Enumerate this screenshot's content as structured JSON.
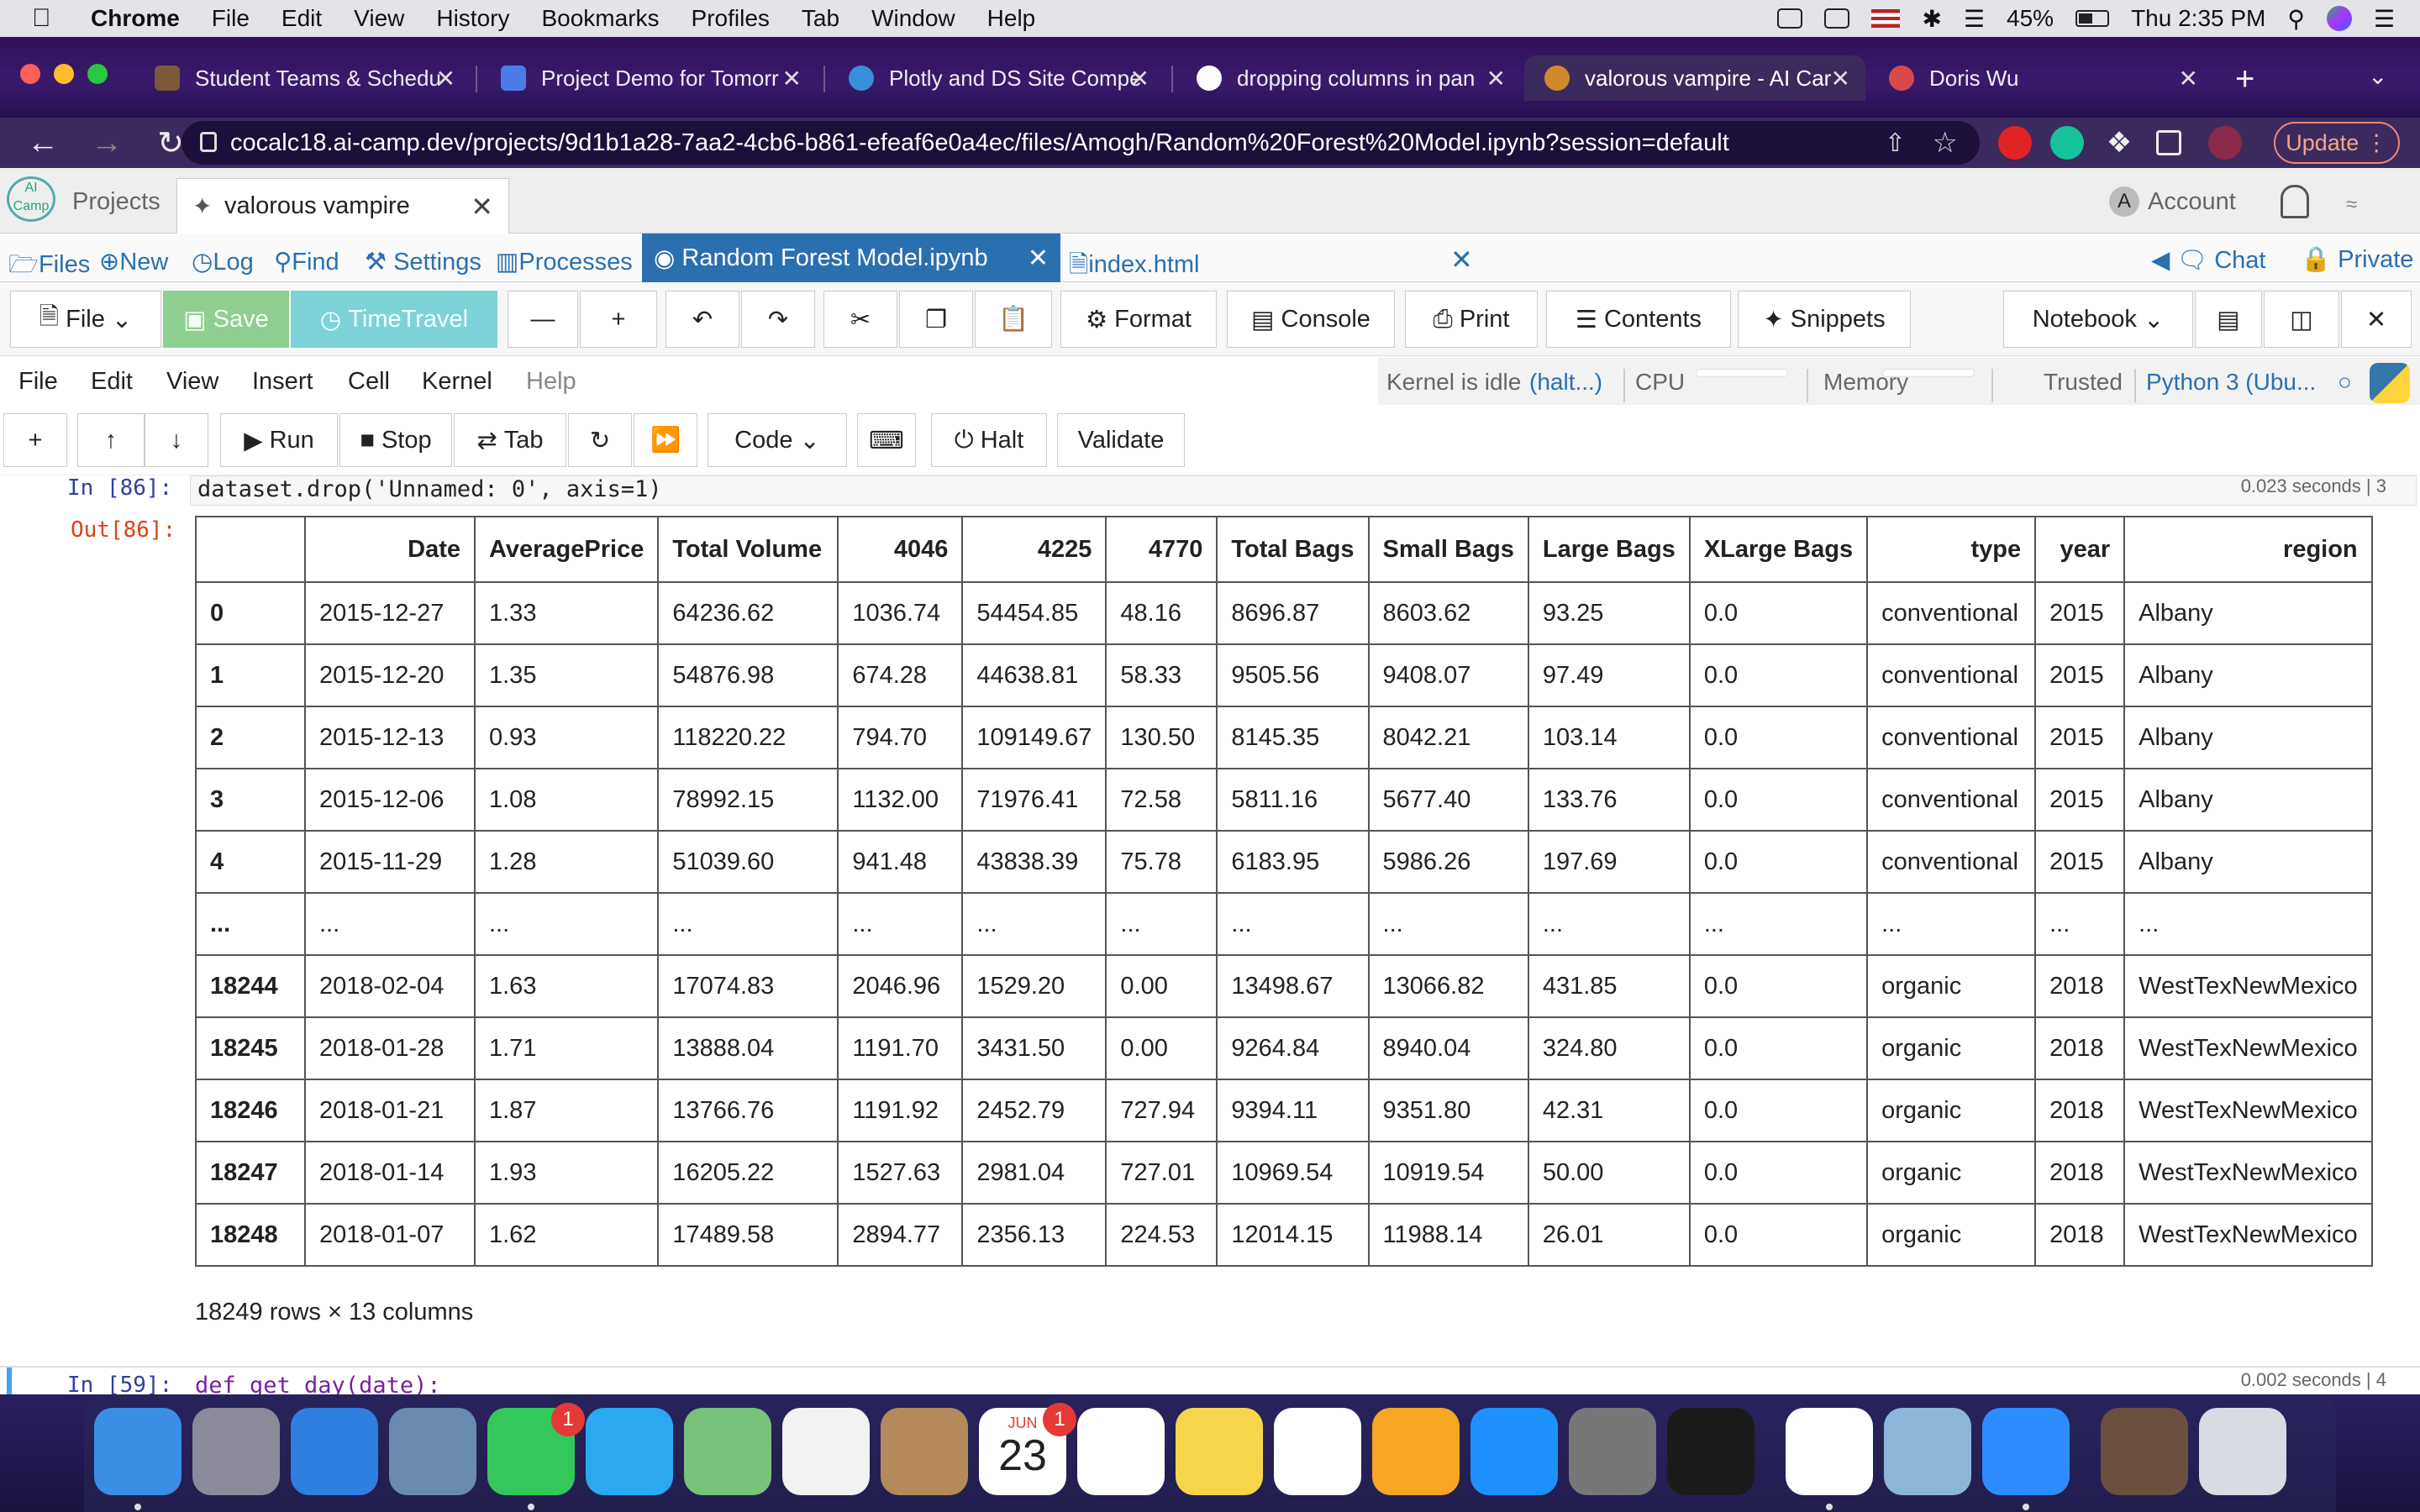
{
  "menubar": {
    "items": [
      "Chrome",
      "File",
      "Edit",
      "View",
      "History",
      "Bookmarks",
      "Profiles",
      "Tab",
      "Window",
      "Help"
    ],
    "battery": "45%",
    "clock": "Thu 2:35 PM"
  },
  "browser_tabs": [
    {
      "title": "Student Teams & Schedu",
      "icon_color": "#7a5a3a"
    },
    {
      "title": "Project Demo for Tomorr",
      "icon_color": "#4a7be8"
    },
    {
      "title": "Plotly and DS Site Compe",
      "icon_color": "#3b8ed8"
    },
    {
      "title": "dropping columns in pan",
      "icon_color": "#ffffff"
    },
    {
      "title": "valorous vampire - AI Car",
      "icon_color": "#d08a2a"
    },
    {
      "title": "Doris Wu",
      "icon_color": "#d84a4a"
    }
  ],
  "address": {
    "url": "cocalc18.ai-camp.dev/projects/9d1b1a28-7aa2-4cb6-b861-efeaf6e0a4ec/files/Amogh/Random%20Forest%20Model.ipynb?session=default",
    "update_label": "Update"
  },
  "project": {
    "projects_label": "Projects",
    "tab_title": "valorous vampire",
    "account_label": "Account",
    "account_initial": "A"
  },
  "filebar": {
    "files": "Files",
    "new": "New",
    "log": "Log",
    "find": "Find",
    "settings": "Settings",
    "processes": "Processes",
    "notebook_tab": "Random Forest Model.ipynb",
    "html_tab": "index.html",
    "chat": "Chat",
    "private": "Private"
  },
  "toolbar": {
    "file": "File",
    "save": "Save",
    "timetravel": "TimeTravel",
    "format": "Format",
    "console": "Console",
    "print": "Print",
    "contents": "Contents",
    "snippets": "Snippets",
    "notebook": "Notebook"
  },
  "nbmenu": {
    "items": [
      "File",
      "Edit",
      "View",
      "Insert",
      "Cell",
      "Kernel",
      "Help"
    ],
    "kernel_status": "Kernel is idle",
    "halt_link": "(halt...)",
    "cpu": "CPU",
    "memory": "Memory",
    "trusted": "Trusted",
    "kernel_name": "Python 3 (Ubu..."
  },
  "celltools": {
    "run": "Run",
    "stop": "Stop",
    "tab": "Tab",
    "celltype": "Code",
    "halt": "Halt",
    "validate": "Validate"
  },
  "cell": {
    "in_prompt": "In [86]:",
    "code": "dataset.drop('Unnamed: 0', axis=1)",
    "timing": "0.023 seconds",
    "timing_count": "3",
    "out_prompt": "Out[86]:",
    "next_in_prompt": "In [59]:",
    "next_code": "def get_day(date):",
    "next_timing": "0.002 seconds",
    "next_count": "4"
  },
  "dataframe": {
    "columns": [
      "",
      "Date",
      "AveragePrice",
      "Total Volume",
      "4046",
      "4225",
      "4770",
      "Total Bags",
      "Small Bags",
      "Large Bags",
      "XLarge Bags",
      "type",
      "year",
      "region"
    ],
    "rows": [
      [
        "0",
        "2015-12-27",
        "1.33",
        "64236.62",
        "1036.74",
        "54454.85",
        "48.16",
        "8696.87",
        "8603.62",
        "93.25",
        "0.0",
        "conventional",
        "2015",
        "Albany"
      ],
      [
        "1",
        "2015-12-20",
        "1.35",
        "54876.98",
        "674.28",
        "44638.81",
        "58.33",
        "9505.56",
        "9408.07",
        "97.49",
        "0.0",
        "conventional",
        "2015",
        "Albany"
      ],
      [
        "2",
        "2015-12-13",
        "0.93",
        "118220.22",
        "794.70",
        "109149.67",
        "130.50",
        "8145.35",
        "8042.21",
        "103.14",
        "0.0",
        "conventional",
        "2015",
        "Albany"
      ],
      [
        "3",
        "2015-12-06",
        "1.08",
        "78992.15",
        "1132.00",
        "71976.41",
        "72.58",
        "5811.16",
        "5677.40",
        "133.76",
        "0.0",
        "conventional",
        "2015",
        "Albany"
      ],
      [
        "4",
        "2015-11-29",
        "1.28",
        "51039.60",
        "941.48",
        "43838.39",
        "75.78",
        "6183.95",
        "5986.26",
        "197.69",
        "0.0",
        "conventional",
        "2015",
        "Albany"
      ],
      [
        "...",
        "...",
        "...",
        "...",
        "...",
        "...",
        "...",
        "...",
        "...",
        "...",
        "...",
        "...",
        "...",
        "..."
      ],
      [
        "18244",
        "2018-02-04",
        "1.63",
        "17074.83",
        "2046.96",
        "1529.20",
        "0.00",
        "13498.67",
        "13066.82",
        "431.85",
        "0.0",
        "organic",
        "2018",
        "WestTexNewMexico"
      ],
      [
        "18245",
        "2018-01-28",
        "1.71",
        "13888.04",
        "1191.70",
        "3431.50",
        "0.00",
        "9264.84",
        "8940.04",
        "324.80",
        "0.0",
        "organic",
        "2018",
        "WestTexNewMexico"
      ],
      [
        "18246",
        "2018-01-21",
        "1.87",
        "13766.76",
        "1191.92",
        "2452.79",
        "727.94",
        "9394.11",
        "9351.80",
        "42.31",
        "0.0",
        "organic",
        "2018",
        "WestTexNewMexico"
      ],
      [
        "18247",
        "2018-01-14",
        "1.93",
        "16205.22",
        "1527.63",
        "2981.04",
        "727.01",
        "10969.54",
        "10919.54",
        "50.00",
        "0.0",
        "organic",
        "2018",
        "WestTexNewMexico"
      ],
      [
        "18248",
        "2018-01-07",
        "1.62",
        "17489.58",
        "2894.77",
        "2356.13",
        "224.53",
        "12014.15",
        "11988.14",
        "26.01",
        "0.0",
        "organic",
        "2018",
        "WestTexNewMexico"
      ]
    ],
    "shape_text": "18249 rows × 13 columns"
  },
  "dock": {
    "badges": {
      "facetime": "1",
      "calendar": "1"
    },
    "calendar_month": "JUN",
    "calendar_day": "23",
    "apps": [
      {
        "name": "finder",
        "color": "#3a8ee6"
      },
      {
        "name": "launchpad",
        "color": "#8a8a9a"
      },
      {
        "name": "safari",
        "color": "#2f7fe0"
      },
      {
        "name": "preview-bird",
        "color": "#6a8bb0"
      },
      {
        "name": "facetime",
        "color": "#34c759"
      },
      {
        "name": "messages",
        "color": "#2aa8f0"
      },
      {
        "name": "maps",
        "color": "#78c27a"
      },
      {
        "name": "photos",
        "color": "#f2f2f2"
      },
      {
        "name": "contacts",
        "color": "#b48a5a"
      },
      {
        "name": "calendar",
        "color": "#ffffff"
      },
      {
        "name": "reminders",
        "color": "#ffffff"
      },
      {
        "name": "notes",
        "color": "#f7d54a"
      },
      {
        "name": "numbers",
        "color": "#ffffff"
      },
      {
        "name": "pages",
        "color": "#f5a623"
      },
      {
        "name": "app-store",
        "color": "#1e90ff"
      },
      {
        "name": "system-preferences",
        "color": "#777777"
      },
      {
        "name": "activity-monitor",
        "color": "#1a1a1a"
      },
      {
        "name": "chrome",
        "color": "#ffffff"
      },
      {
        "name": "image-capture",
        "color": "#8cb6d8"
      },
      {
        "name": "zoom",
        "color": "#2d8cff"
      },
      {
        "name": "photo-thumb",
        "color": "#6b5040"
      },
      {
        "name": "trash",
        "color": "#d8dce2"
      }
    ]
  }
}
